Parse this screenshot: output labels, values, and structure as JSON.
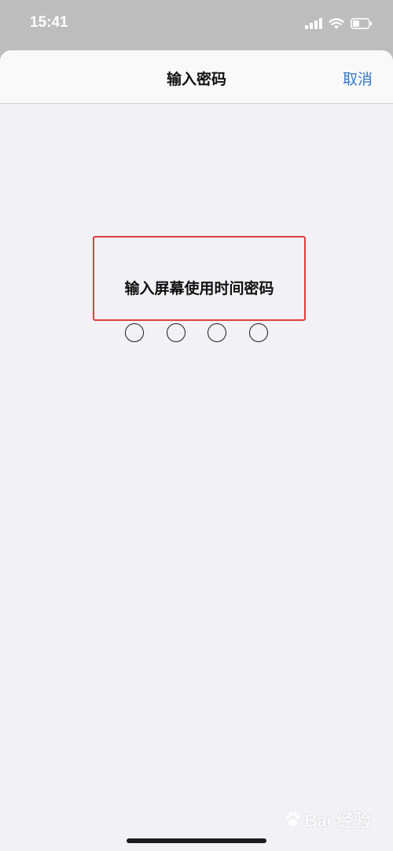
{
  "status_bar": {
    "time": "15:41",
    "icons": [
      "signal-icon",
      "wifi-icon",
      "battery-icon"
    ]
  },
  "nav": {
    "title": "输入密码",
    "cancel_label": "取消"
  },
  "passcode": {
    "prompt": "输入屏幕使用时间密码",
    "digits_total": 4,
    "digits_entered": 0
  },
  "watermark": {
    "text": "Bai 经验"
  },
  "colors": {
    "accent": "#3478c6",
    "highlight": "#e23b3b",
    "sheet_bg": "#f2f1f6"
  }
}
